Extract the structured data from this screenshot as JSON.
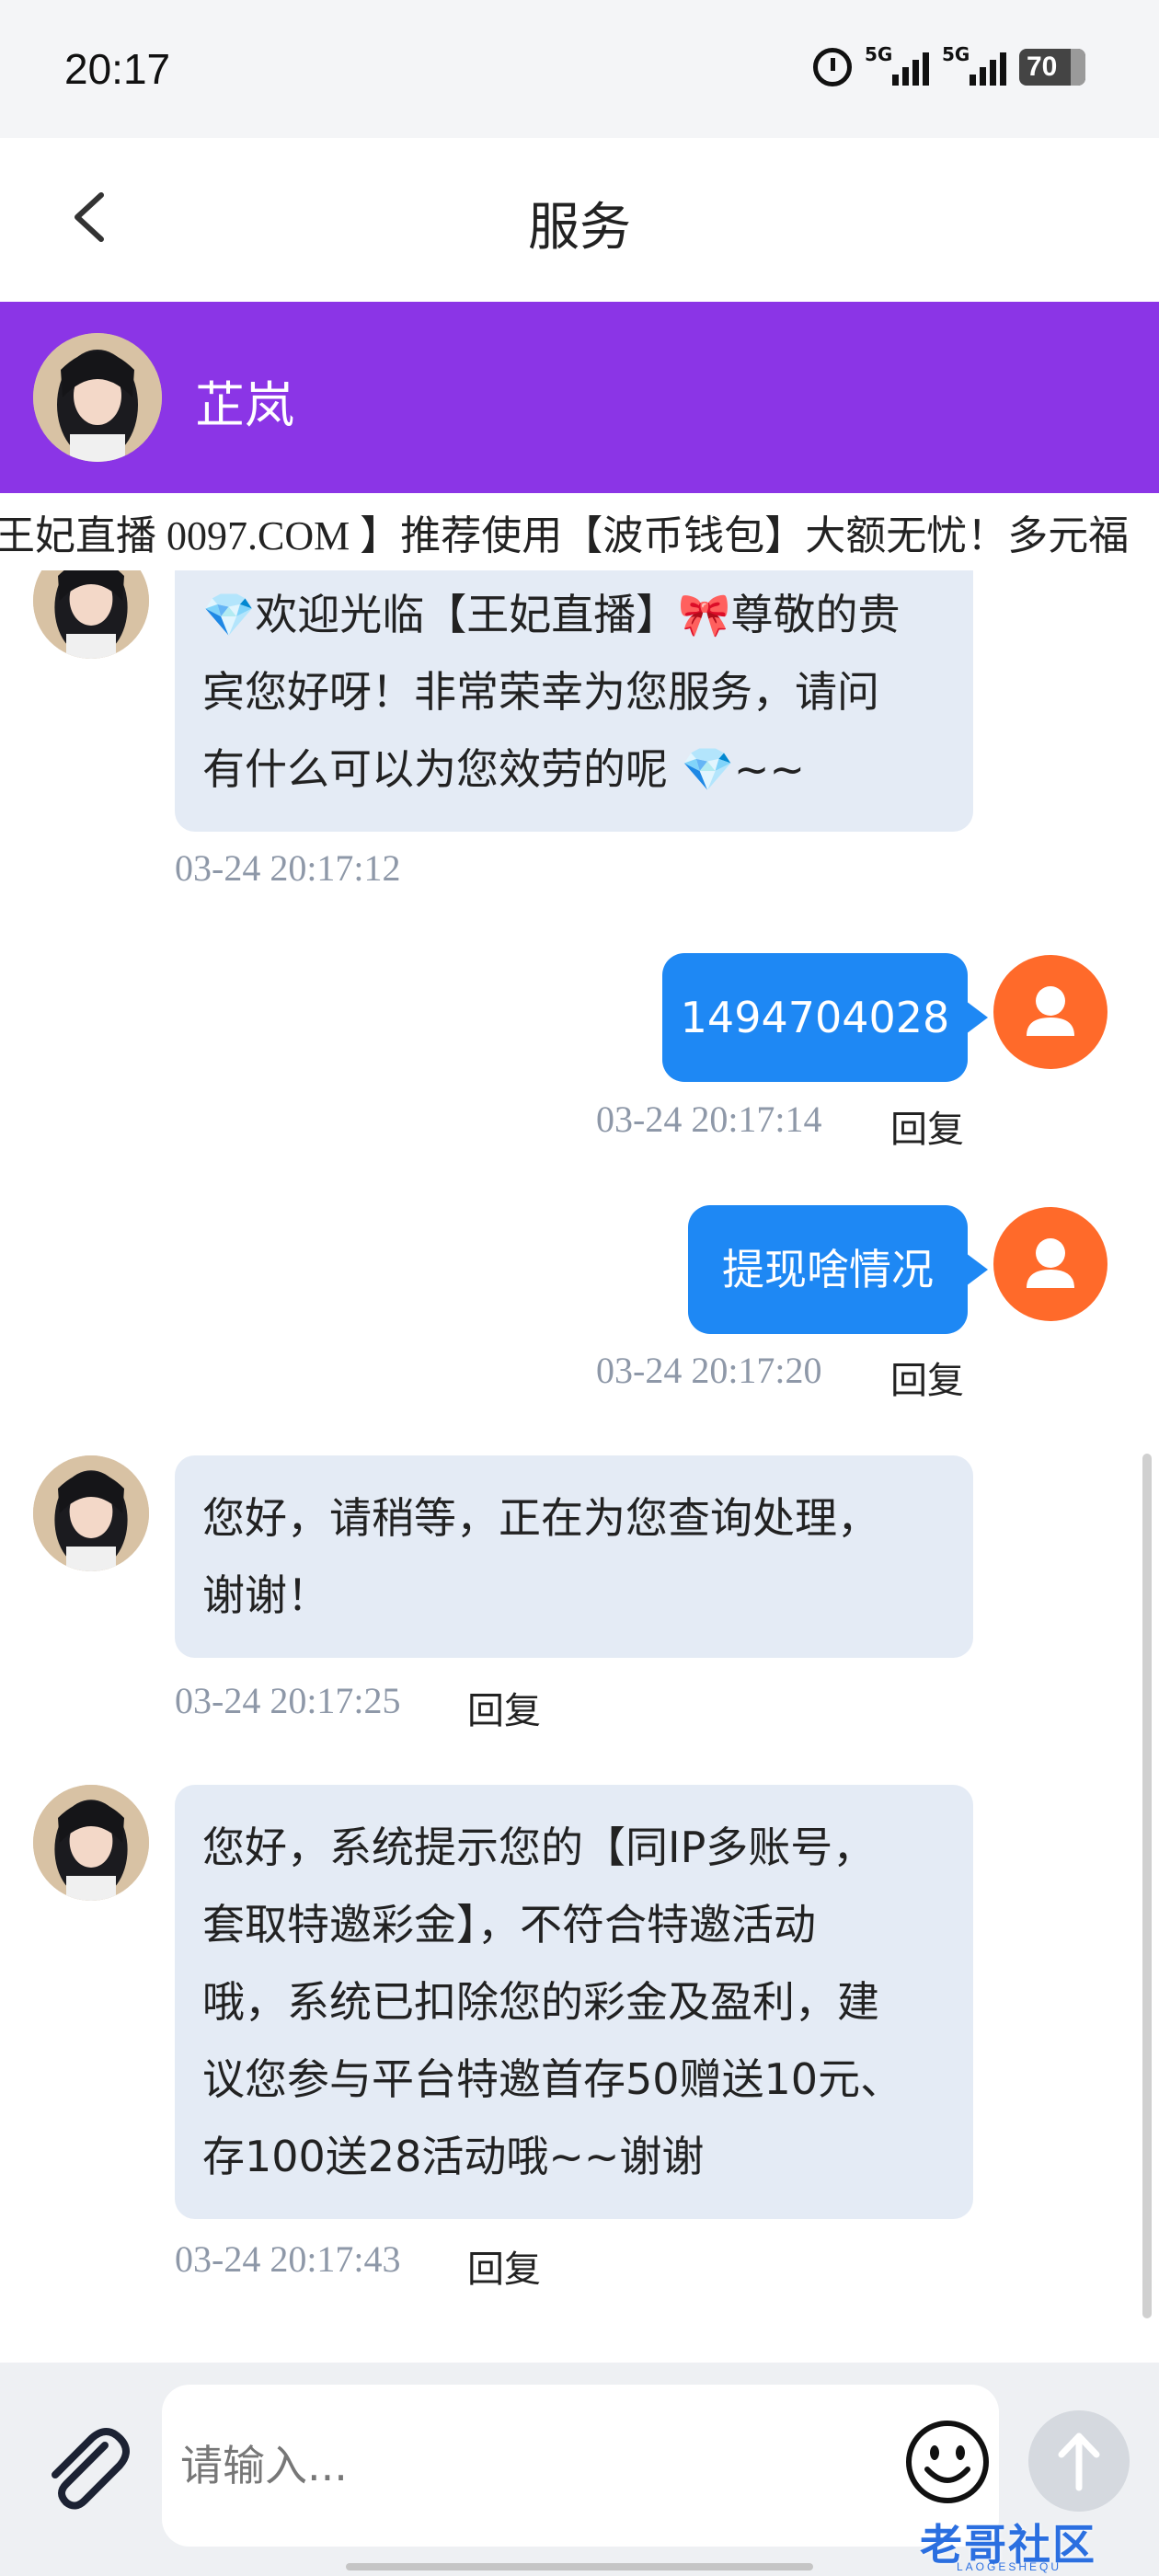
{
  "status_bar": {
    "time": "20:17",
    "network1": "5G",
    "network2": "5G",
    "battery": "70"
  },
  "nav": {
    "title": "服务"
  },
  "agent": {
    "name": "芷岚"
  },
  "marquee": {
    "text": "王妃直播 0097.COM 】推荐使用【波币钱包】大额无忧！多元福"
  },
  "messages": [
    {
      "side": "left",
      "lines": [
        "💎欢迎光临【王妃直播】🎀尊敬的贵",
        "宾您好呀！非常荣幸为您服务，请问",
        "有什么可以为您效劳的呢 💎~~"
      ],
      "time": "03-24 20:17:12"
    },
    {
      "side": "right",
      "text": "1494704028",
      "time": "03-24 20:17:14",
      "reply": "回复"
    },
    {
      "side": "right",
      "text": "提现啥情况",
      "time": "03-24 20:17:20",
      "reply": "回复"
    },
    {
      "side": "left",
      "lines": [
        "您好，请稍等，正在为您查询处理，",
        "谢谢！"
      ],
      "time": "03-24 20:17:25",
      "reply": "回复"
    },
    {
      "side": "left",
      "lines": [
        "您好，系统提示您的【同IP多账号，",
        "套取特邀彩金】，不符合特邀活动",
        "哦，系统已扣除您的彩金及盈利，建",
        "议您参与平台特邀首存50赠送10元、",
        "存100送28活动哦~~谢谢"
      ],
      "time": "03-24 20:17:43",
      "reply": "回复"
    }
  ],
  "input": {
    "placeholder": "请输入..."
  },
  "watermark": {
    "text": "老哥社区",
    "sub": "LAOGESHEQU"
  },
  "colors": {
    "agent_bar": "#8b35e6",
    "user_bubble": "#1e88f4",
    "user_avatar": "#ff6a2a",
    "agent_bubble": "#e4ebf5"
  }
}
